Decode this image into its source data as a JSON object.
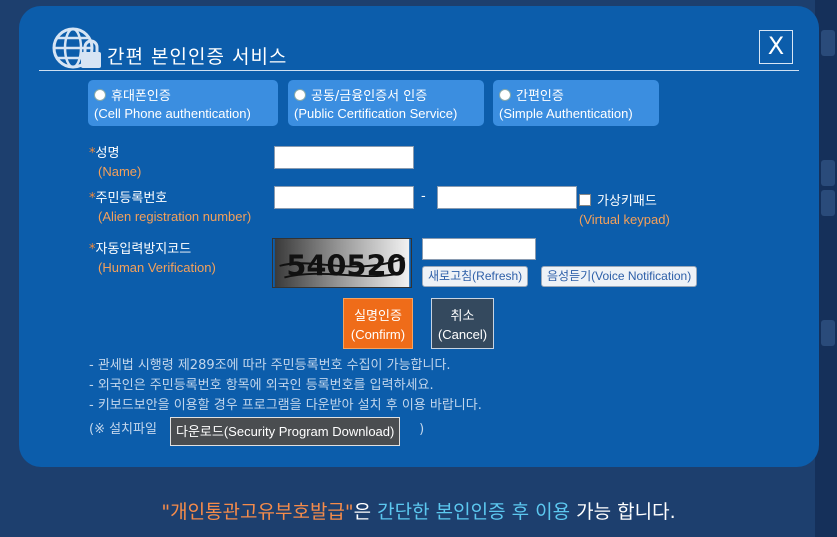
{
  "modal": {
    "title": "간편 본인인증 서비스",
    "close_label": "X"
  },
  "methods": [
    {
      "ko": "휴대폰인증",
      "en": "(Cell Phone authentication)"
    },
    {
      "ko": "공동/금융인증서 인증",
      "en": "(Public Certification Service)"
    },
    {
      "ko": "간편인증",
      "en": "(Simple Authentication)"
    }
  ],
  "fields": {
    "name": {
      "star": "*",
      "ko": "성명",
      "en": "(Name)",
      "value": ""
    },
    "rrn": {
      "star": "*",
      "ko": "주민등록번호",
      "en": "(Alien registration number)",
      "first": "",
      "second": "",
      "dash": "-"
    },
    "captcha": {
      "star": "*",
      "ko": "자동입력방지코드",
      "en": "(Human Verification)",
      "value": "",
      "code": "540520"
    }
  },
  "virtual_keypad": {
    "ko": "가상키패드",
    "en": "(Virtual keypad)"
  },
  "buttons": {
    "refresh": "새로고침(Refresh)",
    "voice": "음성듣기(Voice Notification)",
    "confirm_ko": "실명인증",
    "confirm_en": "(Confirm)",
    "cancel_ko": "취소",
    "cancel_en": "(Cancel)"
  },
  "notes": [
    "- 관세법 시행령 제289조에 따라 주민등록번호 수집이 가능합니다.",
    "- 외국인은 주민등록번호 항목에 외국인 등록번호를 입력하세요.",
    "- 키보드보안을 이용할 경우 프로그램을 다운받아 설치 후 이용 바랍니다."
  ],
  "note_last_prefix": "(※ 설치파일",
  "note_last_suffix": ")",
  "tooltip": "다운로드(Security Program Download)",
  "footer": {
    "part1": "\"개인통관고유부호발급\"",
    "part2": "은",
    "part3": "간단한 본인인증 후 이용",
    "part4": "가능 합니다."
  },
  "colors": {
    "modal_bg": "#0c5dab",
    "page_bg": "#1d3f6e",
    "accent_orange": "#ef6c19",
    "label_orange": "#f4a05a",
    "method_bg": "#3b8ee0",
    "footer_cyan": "#5cc8f0"
  }
}
